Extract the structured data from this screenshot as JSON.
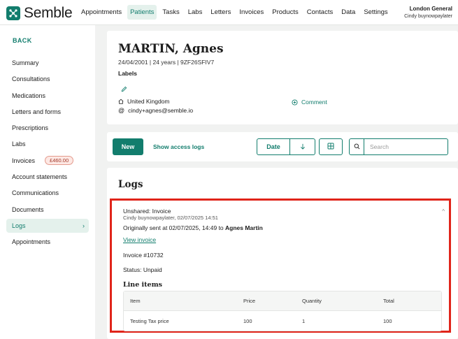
{
  "brand": {
    "name": "Semble",
    "accent": "#127d6d"
  },
  "nav": {
    "items": [
      "Appointments",
      "Patients",
      "Tasks",
      "Labs",
      "Letters",
      "Invoices",
      "Products",
      "Contacts",
      "Data",
      "Settings"
    ],
    "active": "Patients"
  },
  "account": {
    "org": "London General",
    "user": "Cindy buynowpaylater"
  },
  "sidebar": {
    "back": "BACK",
    "items": [
      "Summary",
      "Consultations",
      "Medications",
      "Letters and forms",
      "Prescriptions",
      "Labs",
      "Invoices",
      "Account statements",
      "Communications",
      "Documents",
      "Logs",
      "Appointments"
    ],
    "invoices_badge": "£460.00",
    "active": "Logs"
  },
  "patient": {
    "name": "MARTIN, Agnes",
    "meta": "24/04/2001  |  24 years  |  9ZF26SFIV7",
    "labels_title": "Labels",
    "country": "United Kingdom",
    "email": "cindy+agnes@semble.io",
    "comment_label": "Comment"
  },
  "toolbar": {
    "new_label": "New",
    "show_access_logs": "Show access logs",
    "date_label": "Date",
    "search_placeholder": "Search"
  },
  "logs": {
    "title": "Logs",
    "entry": {
      "heading": "Unshared: Invoice",
      "subheading": "Cindy buynowpaylater, 02/07/2025 14:51",
      "sent_prefix": "Originally sent at 02/07/2025, 14:49 to ",
      "sent_to": "Agnes Martin",
      "view_invoice": "View invoice",
      "invoice_number": "Invoice #10732",
      "status": "Status: Unpaid",
      "line_items_title": "Line items",
      "columns": [
        "Item",
        "Price",
        "Quantity",
        "Total"
      ],
      "rows": [
        [
          "Testing Tax price",
          "100",
          "1",
          "100"
        ]
      ]
    }
  }
}
